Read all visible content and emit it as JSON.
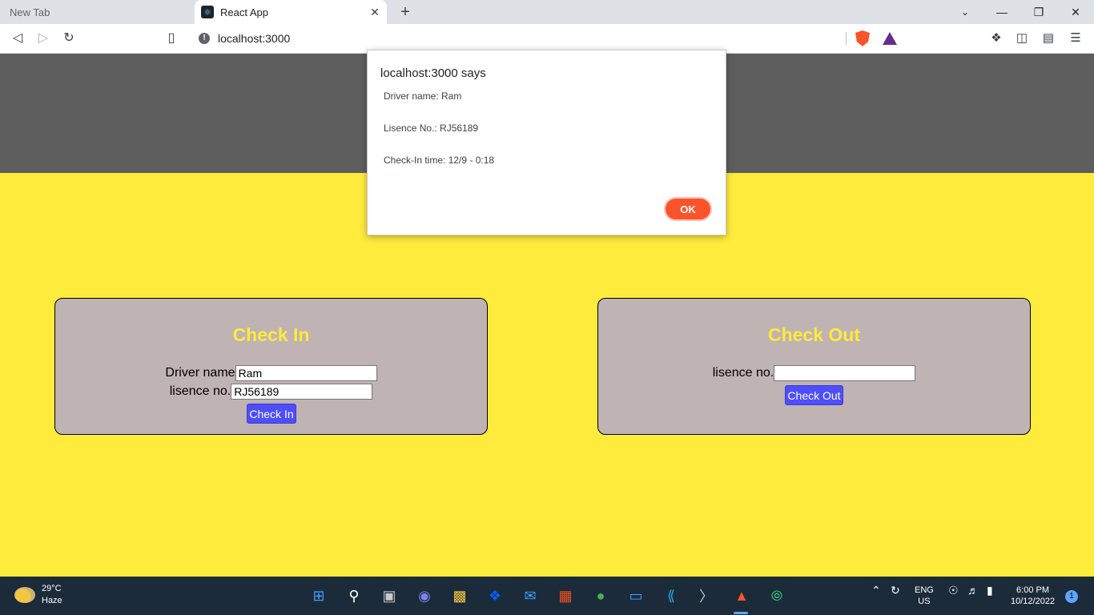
{
  "browser": {
    "tabs": [
      {
        "label": "New Tab"
      },
      {
        "label": "React App"
      }
    ],
    "url": "localhost:3000",
    "win_minimize": "—",
    "win_restore": "❐",
    "win_close": "✕"
  },
  "dialog": {
    "title": "localhost:3000 says",
    "lines": [
      "Driver name: Ram",
      "Lisence No.: RJ56189",
      "Check-In time: 12/9 - 0:18"
    ],
    "ok_label": "OK"
  },
  "checkin": {
    "title": "Check In",
    "driver_label": "Driver name",
    "driver_value": "Ram",
    "license_label": "lisence no.",
    "license_value": "RJ56189",
    "button_label": "Check In"
  },
  "checkout": {
    "title": "Check Out",
    "license_label": "lisence no.",
    "license_value": "",
    "button_label": "Check Out"
  },
  "taskbar": {
    "temperature": "29°C",
    "weather": "Haze",
    "lang_top": "ENG",
    "lang_bottom": "US",
    "time": "6:00 PM",
    "date": "10/12/2022",
    "notifications": "1"
  }
}
